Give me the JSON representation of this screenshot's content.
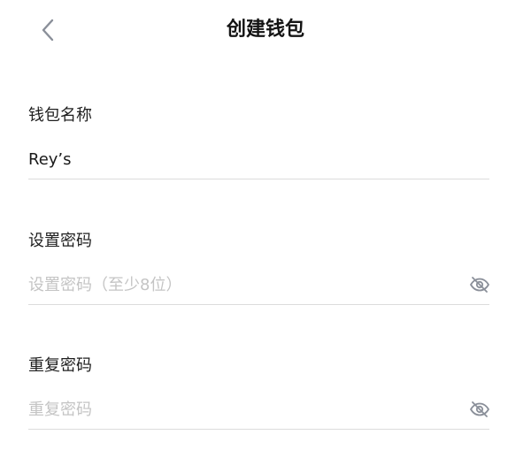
{
  "header": {
    "title": "创建钱包",
    "back_icon": "chevron-left-icon"
  },
  "form": {
    "wallet_name": {
      "label": "钱包名称",
      "value": "Rey’s"
    },
    "password": {
      "label": "设置密码",
      "placeholder": "设置密码（至少8位）",
      "visibility_icon": "eye-off-icon"
    },
    "repeat_password": {
      "label": "重复密码",
      "placeholder": "重复密码",
      "visibility_icon": "eye-off-icon"
    }
  },
  "colors": {
    "text": "#1a1a1a",
    "placeholder": "#c4c4c4",
    "divider": "#dcdcdc",
    "icon": "#8a8f99"
  }
}
